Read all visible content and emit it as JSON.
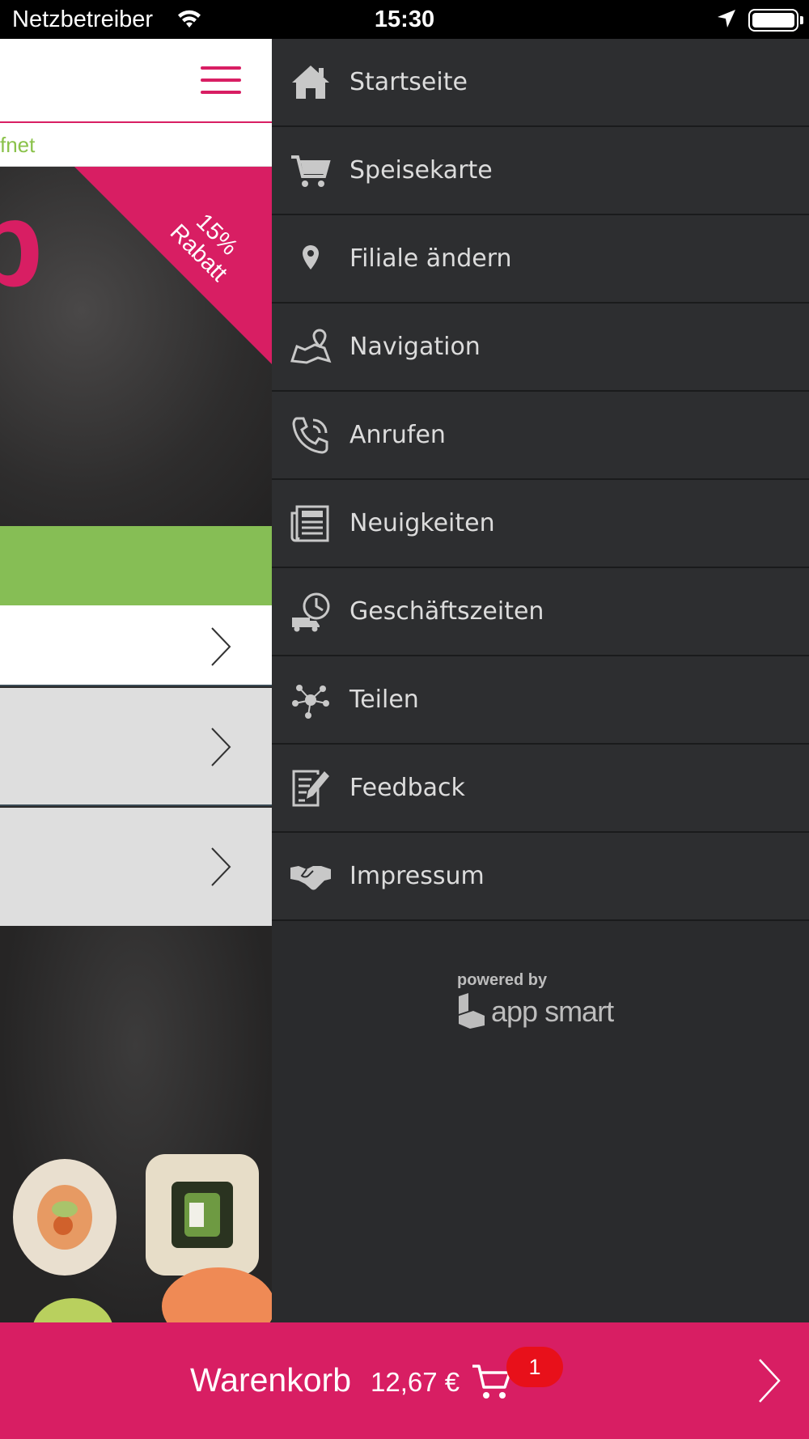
{
  "status_bar": {
    "carrier": "Netzbetreiber",
    "time": "15:30"
  },
  "page": {
    "status_text": "fnet",
    "ribbon_line1": "15%",
    "ribbon_line2": "Rabatt",
    "logo_letter": "p"
  },
  "menu": {
    "items": [
      {
        "label": "Startseite",
        "icon": "home-icon"
      },
      {
        "label": "Speisekarte",
        "icon": "cart-icon"
      },
      {
        "label": "Filiale ändern",
        "icon": "location-pin-icon"
      },
      {
        "label": "Navigation",
        "icon": "map-icon"
      },
      {
        "label": "Anrufen",
        "icon": "phone-icon"
      },
      {
        "label": "Neuigkeiten",
        "icon": "newspaper-icon"
      },
      {
        "label": "Geschäftszeiten",
        "icon": "delivery-clock-icon"
      },
      {
        "label": "Teilen",
        "icon": "share-icon"
      },
      {
        "label": "Feedback",
        "icon": "feedback-icon"
      },
      {
        "label": "Impressum",
        "icon": "handshake-icon"
      }
    ],
    "powered_by": "powered by",
    "brand": "app smart"
  },
  "cart": {
    "label": "Warenkorb",
    "amount": "12,67 €",
    "count": "1"
  },
  "colors": {
    "accent": "#d81e63",
    "green": "#86be55",
    "drawer_bg": "#2d2e30",
    "badge": "#e8101a"
  }
}
